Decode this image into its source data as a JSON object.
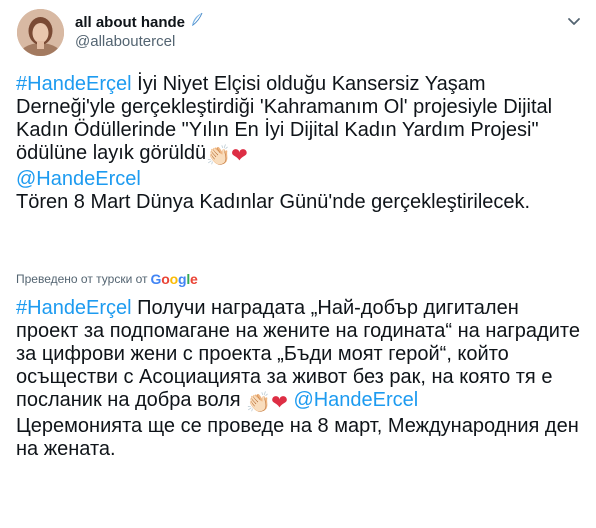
{
  "author": {
    "display_name": "all about hande",
    "handle": "@allaboutercel",
    "badge_icon": "feather-icon"
  },
  "menu": {
    "icon": "chevron-down-icon"
  },
  "original": {
    "hashtag": "#HandeErçel",
    "text_part1": " İyi Niyet Elçisi olduğu Kansersiz Yaşam Derneği'yle gerçekleştirdiği 'Kahramanım Ol' projesiyle Dijital Kadın Ödüllerinde \"Yılın En İyi Dijital Kadın Yardım Projesi\" ödülüne layık görüldü",
    "mention": "@HandeErcel",
    "text_part2": "Tören 8 Mart Dünya Kadınlar Günü'nde gerçekleştirilecek."
  },
  "translation_note": {
    "label": "Преведено от турски от",
    "provider": "Google"
  },
  "translated": {
    "hashtag": "#HandeErçel",
    "text_part1": " Получи наградата „Най-добър дигитален проект за подпомагане на жените на годината“ на наградите за цифрови жени с проекта „Бъди моят герой“, който осъществи с Асоциацията за живот без рак, на която тя е посланик на добра воля",
    "mention": "@HandeErcel",
    "text_part2": " Церемонията ще се проведе на 8 март, Международния ден на жената."
  },
  "emoji": {
    "clap": "👏🏻",
    "heart": "❤"
  },
  "colors": {
    "link": "#1d9bf0",
    "text": "#0f1419",
    "muted": "#536471"
  }
}
